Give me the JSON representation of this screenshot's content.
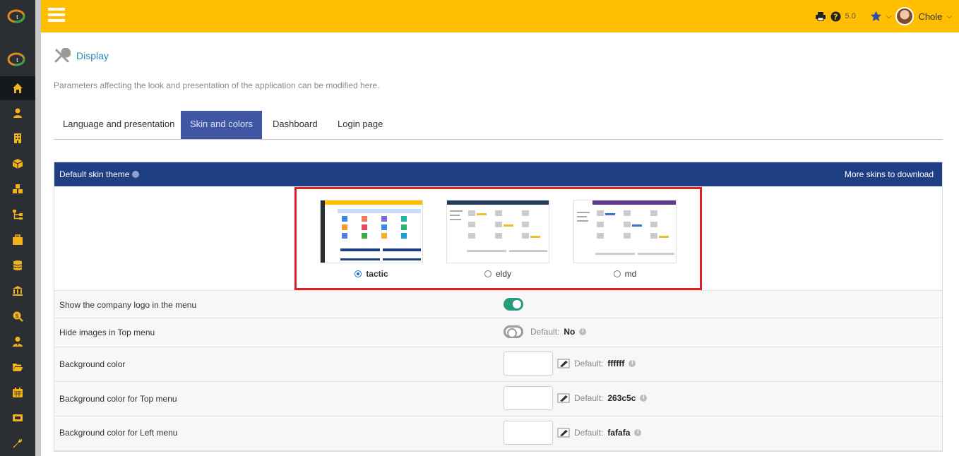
{
  "topbar": {
    "version": "5.0",
    "user_name": "Chole"
  },
  "page": {
    "title": "Display",
    "description": "Parameters affecting the look and presentation of the application can be modified here."
  },
  "tabs": [
    {
      "label": "Language and presentation"
    },
    {
      "label": "Skin and colors",
      "active": true
    },
    {
      "label": "Dashboard"
    },
    {
      "label": "Login page"
    }
  ],
  "table": {
    "header_left": "Default skin theme",
    "header_right": "More skins to download",
    "skins": [
      {
        "label": "tactic",
        "selected": true
      },
      {
        "label": "eldy",
        "selected": false
      },
      {
        "label": "md",
        "selected": false
      }
    ],
    "rows": {
      "company_logo": {
        "label": "Show the company logo in the menu",
        "value": "on"
      },
      "hide_images": {
        "label": "Hide images in Top menu",
        "default_label": "Default:",
        "default_value": "No"
      },
      "bg_color": {
        "label": "Background color",
        "default_label": "Default:",
        "default_value": "ffffff"
      },
      "bg_top": {
        "label": "Background color for Top menu",
        "default_label": "Default:",
        "default_value": "263c5c"
      },
      "bg_left": {
        "label": "Background color for Left menu",
        "default_label": "Default:",
        "default_value": "fafafa"
      }
    }
  },
  "colors": {
    "topbar": "#ffbf00",
    "sidebar": "#2b2f33",
    "active_tab": "#3f57a3",
    "table_header": "#1f3f85",
    "highlight_box": "#e31e24",
    "sidebar_icon": "#f2b31a"
  },
  "sidebar_icons": [
    "home-icon",
    "user-icon",
    "building-icon",
    "box-icon",
    "cubes-icon",
    "sitemap-icon",
    "briefcase-icon",
    "coins-icon",
    "bank-icon",
    "search-dollar-icon",
    "user-tie-icon",
    "folder-open-icon",
    "calendar-icon",
    "ticket-icon",
    "wrench-icon"
  ]
}
